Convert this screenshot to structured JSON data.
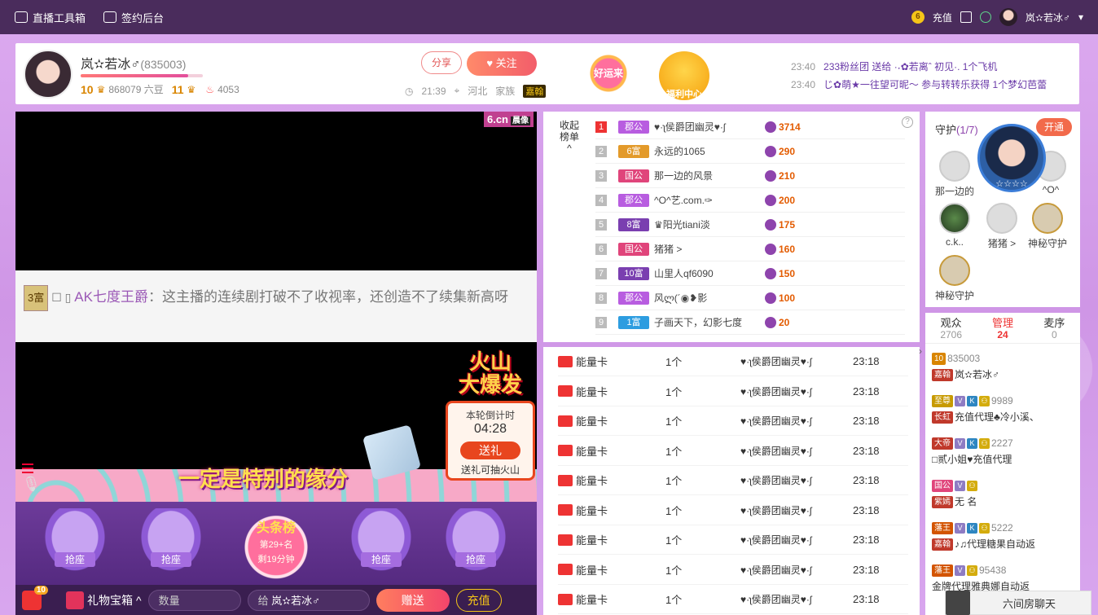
{
  "topbar": {
    "toolbox": "直播工具箱",
    "contract": "签约后台",
    "recharge": "充值",
    "username": "岚✫若冰♂"
  },
  "host": {
    "name": "岚✫若冰♂",
    "id": "(835003)",
    "level": "10",
    "beans": "868079 六豆",
    "fan_level": "11",
    "heat": "4053",
    "time": "21:39",
    "location": "河北",
    "family_label": "家族",
    "family_badge": "嘉翰",
    "share": "分享",
    "follow": "关注"
  },
  "promo": {
    "luck": "好运来",
    "welfare": "福利中心"
  },
  "notices": [
    {
      "time": "23:40",
      "text": "233粉丝团 送给 ·˖✿若离ˆ 初见·. 1个飞机"
    },
    {
      "time": "23:40",
      "text": "じ✿萌★一往望可昵～ 参与转转乐获得 1个梦幻芭蕾"
    }
  ],
  "video": {
    "logo": "6.cn",
    "logo_tag": "晨像",
    "chat_level": "3富",
    "chat_user": "AK七度王爵",
    "chat_text": "：这主播的连续剧打破不了收视率，还创造不了续集新高呀",
    "caption": "一定是特别的缘分"
  },
  "volcano": {
    "title1": "火山",
    "title2": "大爆发",
    "countdown_label": "本轮倒计时",
    "countdown": "04:28",
    "send": "送礼",
    "tip": "送礼可抽火山"
  },
  "seats": {
    "label": "抢座",
    "top_title": "头条榜",
    "rank": "第29+名",
    "remain": "剩19分钟"
  },
  "bottom": {
    "bag_count": "10",
    "gift_box": "礼物宝箱",
    "qty_placeholder": "数量",
    "to_label": "给",
    "to_name": "岚✫若冰♂",
    "give": "赠送",
    "recharge": "充值"
  },
  "ranking": {
    "fold1": "收起",
    "fold2": "榜单",
    "help": "?",
    "rows": [
      {
        "n": "1",
        "badge": "郡公",
        "color": "#b85de0",
        "name": "♥·ʅ侯爵团幽灵♥·ʃ",
        "score": "3714"
      },
      {
        "n": "2",
        "badge": "6富",
        "color": "#e39a2a",
        "name": "永远的1065",
        "score": "290"
      },
      {
        "n": "3",
        "badge": "国公",
        "color": "#e0457b",
        "name": "那一边的风景",
        "score": "210"
      },
      {
        "n": "4",
        "badge": "郡公",
        "color": "#b85de0",
        "name": "^O^艺.com.✑",
        "score": "200"
      },
      {
        "n": "5",
        "badge": "8富",
        "color": "#7a3fb0",
        "name": "♛阳光tiani淡",
        "score": "175"
      },
      {
        "n": "6",
        "badge": "国公",
        "color": "#e0457b",
        "name": "猪猪 >",
        "score": "160"
      },
      {
        "n": "7",
        "badge": "10富",
        "color": "#7a3fb0",
        "name": "山里人qf6090",
        "score": "150"
      },
      {
        "n": "8",
        "badge": "郡公",
        "color": "#b85de0",
        "name": "风ლ(´◉❥影",
        "score": "100"
      },
      {
        "n": "9",
        "badge": "1富",
        "color": "#2d9de0",
        "name": "子画天下，幻影七度",
        "score": "20"
      }
    ]
  },
  "gifts": [
    {
      "name": "能量卡",
      "count": "1个",
      "user": "♥·ʅ侯爵团幽灵♥·ʃ",
      "time": "23:18"
    },
    {
      "name": "能量卡",
      "count": "1个",
      "user": "♥·ʅ侯爵团幽灵♥·ʃ",
      "time": "23:18"
    },
    {
      "name": "能量卡",
      "count": "1个",
      "user": "♥·ʅ侯爵团幽灵♥·ʃ",
      "time": "23:18"
    },
    {
      "name": "能量卡",
      "count": "1个",
      "user": "♥·ʅ侯爵团幽灵♥·ʃ",
      "time": "23:18"
    },
    {
      "name": "能量卡",
      "count": "1个",
      "user": "♥·ʅ侯爵团幽灵♥·ʃ",
      "time": "23:18"
    },
    {
      "name": "能量卡",
      "count": "1个",
      "user": "♥·ʅ侯爵团幽灵♥·ʃ",
      "time": "23:18"
    },
    {
      "name": "能量卡",
      "count": "1个",
      "user": "♥·ʅ侯爵团幽灵♥·ʃ",
      "time": "23:18"
    },
    {
      "name": "能量卡",
      "count": "1个",
      "user": "♥·ʅ侯爵团幽灵♥·ʃ",
      "time": "23:18"
    },
    {
      "name": "能量卡",
      "count": "1个",
      "user": "♥·ʅ侯爵团幽灵♥·ʃ",
      "time": "23:18"
    }
  ],
  "guard": {
    "title": "守护",
    "count": "(1/7)",
    "open": "开通",
    "float_stars": "☆☆☆☆",
    "slots": [
      "那一边的",
      "^O^",
      "c.k..",
      "猪猪 >",
      "神秘守护",
      "神秘守护"
    ]
  },
  "audience": {
    "tabs": [
      {
        "label": "观众",
        "value": "2706"
      },
      {
        "label": "管理",
        "value": "24"
      },
      {
        "label": "麦序",
        "value": "0"
      }
    ],
    "rows": [
      {
        "tag": "10",
        "tagcolor": "#d98500",
        "num": "835003",
        "sub_tag": "嘉翰",
        "name": "岚✫若冰♂"
      },
      {
        "tag": "至尊",
        "tagcolor": "#c79a00",
        "num": "9989",
        "sub_tag": "长虹",
        "name": "充值代理♣冷小溪、"
      },
      {
        "tag": "大帝",
        "tagcolor": "#c0392b",
        "num": "2227",
        "sub_tag": "",
        "name": "□贰小姐♥充值代理"
      },
      {
        "tag": "国公",
        "tagcolor": "#e0457b",
        "num": "",
        "sub_tag": "紫嫣",
        "name": "无 名"
      },
      {
        "tag": "藩王",
        "tagcolor": "#d35400",
        "num": "5222",
        "sub_tag": "嘉翰",
        "name": "♪♫代理糖果自动返"
      },
      {
        "tag": "藩王",
        "tagcolor": "#d35400",
        "num": "95438",
        "sub_tag": "",
        "name": "金牌代理雅典娜自动返"
      }
    ]
  },
  "chat": {
    "label": "六间房聊天"
  }
}
